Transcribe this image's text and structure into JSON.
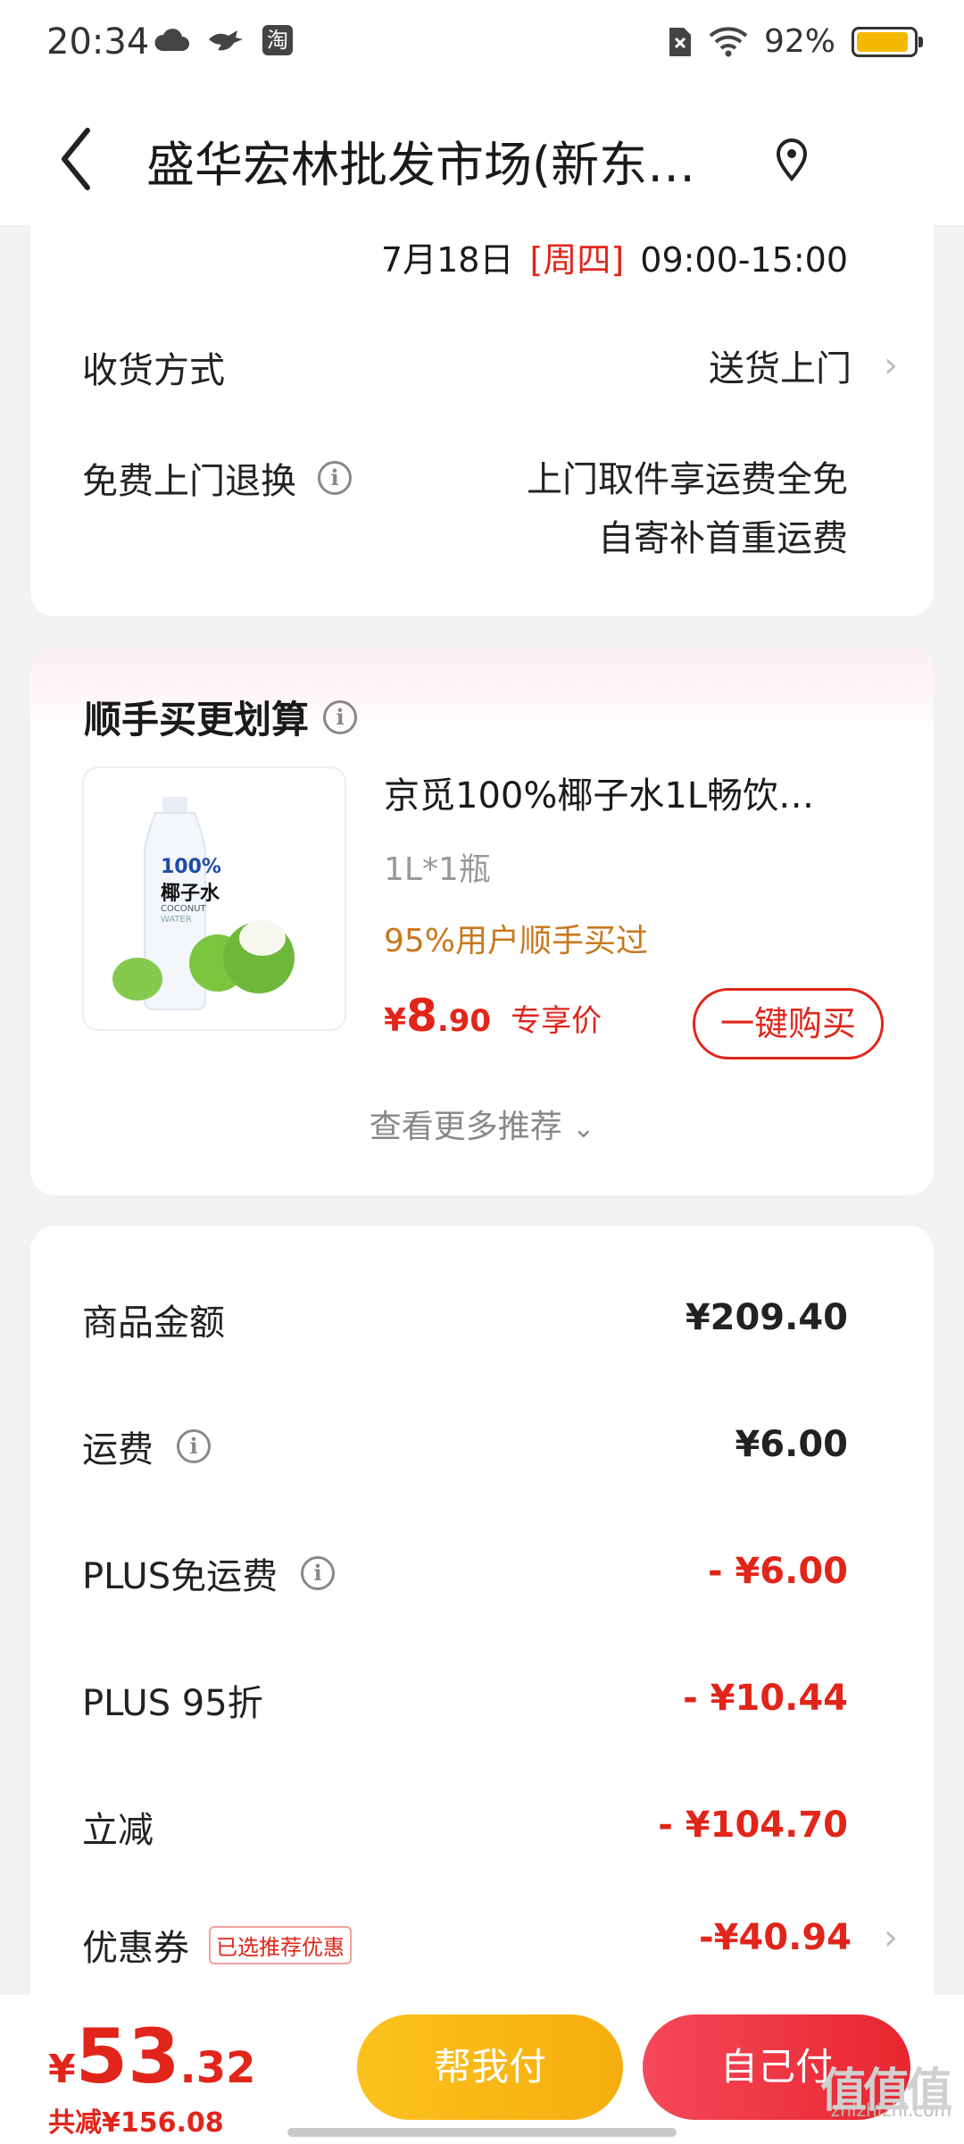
{
  "status_bar": {
    "time": "20:34",
    "battery_text": "92%",
    "battery_level": 0.92,
    "icons": [
      "cloud-icon",
      "bird-icon",
      "taobao-icon",
      "sim-icon",
      "wifi-icon",
      "battery-icon"
    ],
    "taobao_glyph": "淘"
  },
  "header": {
    "title": "盛华宏林批发市场(新东…"
  },
  "delivery": {
    "date": "7月18日",
    "weekday": "[周四]",
    "time_range": "09:00-15:00",
    "method_label": "收货方式",
    "method_value": "送货上门",
    "return_label": "免费上门退换",
    "return_line1": "上门取件享运费全免",
    "return_line2": "自寄补首重运费"
  },
  "recommend": {
    "title": "顺手买更划算",
    "product_name": "京觅100%椰子水1L畅饮…",
    "spec": "1L*1瓶",
    "social_proof": "95%用户顺手买过",
    "currency": "¥",
    "price_int": "8",
    "price_dec": ".90",
    "price_tag": "专享价",
    "buy_button": "一键购买",
    "more": "查看更多推荐",
    "bottle_text_1": "100%",
    "bottle_text_2": "椰子水",
    "bottle_text_3": "COCONUT",
    "bottle_text_4": "WATER"
  },
  "summary": {
    "rows": [
      {
        "label": "商品金额",
        "value": "¥209.40"
      },
      {
        "label": "运费",
        "value": "¥6.00"
      },
      {
        "label": "PLUS免运费",
        "value": "- ¥6.00"
      },
      {
        "label": "PLUS 95折",
        "value": "- ¥10.44"
      },
      {
        "label": "立减",
        "value": "- ¥104.70"
      },
      {
        "label": "优惠券",
        "value": "-¥40.94",
        "badge": "已选推荐优惠"
      }
    ]
  },
  "bottom": {
    "currency": "¥",
    "total_int": "53",
    "total_dec": ".32",
    "saved": "共减¥156.08",
    "help_pay": "帮我付",
    "self_pay": "自己付"
  },
  "watermark": {
    "big": "值值值",
    "small": "zhizhizhi.com"
  },
  "colors": {
    "accent_red": "#e1251b",
    "orange_text": "#c8781c",
    "help_pay_yellow": "#f9b613",
    "self_pay_red": "#f0313d"
  }
}
